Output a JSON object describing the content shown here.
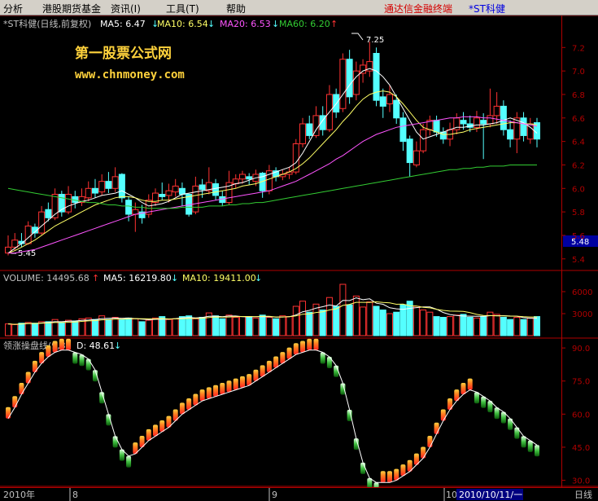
{
  "menu": {
    "items": [
      "分析",
      "港股期货基金",
      "资讯(I)",
      "工具(T)",
      "帮助"
    ],
    "brand": "通达信金融终端",
    "stock": "*ST科健"
  },
  "price_panel": {
    "label": "*ST科健(日线,前复权)",
    "ma5": "MA5: 6.47",
    "ma10": "MA10: 6.54",
    "ma20": "MA20: 6.53",
    "ma60": "MA60: 6.20",
    "watermark_name": "第一股票公式网",
    "watermark_url": "www.chnmoney.com",
    "high_label": "7.25",
    "low_label": "5.45",
    "current_price": "5.48",
    "colors": {
      "up": "#ff3232",
      "down": "#54ffff",
      "ma5": "#ffffff",
      "ma10": "#ffff66",
      "ma20": "#ff55ff",
      "ma60": "#33cc33",
      "axis": "#b00000"
    }
  },
  "volume_panel": {
    "label": "VOLUME: 14495.68",
    "ma5": "MA5: 16219.80",
    "ma10": "MA10: 19411.00"
  },
  "indicator_panel": {
    "label": "领涨操盘线(9,3)",
    "d_value": "D: 48.61"
  },
  "chart_data": [
    {
      "type": "candlestick",
      "title": "*ST科健(日线,前复权)",
      "y_ticks": [
        "7.2",
        "7.0",
        "6.8",
        "6.6",
        "6.4",
        "6.2",
        "6.0",
        "5.8",
        "5.6",
        "5.4"
      ],
      "ylim": [
        5.35,
        7.32
      ],
      "candles": [
        [
          5.45,
          5.5,
          5.6,
          5.43
        ],
        [
          5.5,
          5.56,
          5.62,
          5.47
        ],
        [
          5.55,
          5.53,
          5.62,
          5.5
        ],
        [
          5.53,
          5.68,
          5.72,
          5.52
        ],
        [
          5.67,
          5.62,
          5.7,
          5.58
        ],
        [
          5.62,
          5.8,
          5.85,
          5.6
        ],
        [
          5.82,
          5.75,
          5.88,
          5.72
        ],
        [
          5.75,
          5.95,
          6.0,
          5.73
        ],
        [
          5.95,
          5.8,
          5.98,
          5.76
        ],
        [
          5.8,
          5.95,
          6.02,
          5.78
        ],
        [
          5.93,
          5.88,
          5.98,
          5.83
        ],
        [
          5.88,
          5.93,
          6.0,
          5.85
        ],
        [
          5.92,
          6.0,
          6.06,
          5.89
        ],
        [
          6.0,
          5.96,
          6.08,
          5.92
        ],
        [
          5.97,
          6.06,
          6.12,
          5.94
        ],
        [
          6.06,
          6.0,
          6.14,
          5.96
        ],
        [
          6.0,
          6.1,
          6.18,
          5.97
        ],
        [
          6.12,
          5.92,
          6.13,
          5.88
        ],
        [
          5.9,
          5.78,
          5.93,
          5.72
        ],
        [
          5.78,
          5.82,
          5.88,
          5.63
        ],
        [
          5.8,
          5.75,
          5.86,
          5.7
        ],
        [
          5.78,
          5.9,
          5.95,
          5.75
        ],
        [
          5.88,
          5.96,
          6.0,
          5.85
        ],
        [
          5.95,
          5.93,
          6.05,
          5.9
        ],
        [
          5.94,
          5.98,
          6.04,
          5.88
        ],
        [
          5.97,
          6.02,
          6.08,
          5.93
        ],
        [
          6.0,
          5.95,
          6.05,
          5.85
        ],
        [
          5.95,
          5.78,
          5.96,
          5.76
        ],
        [
          5.8,
          6.02,
          6.1,
          5.78
        ],
        [
          6.03,
          5.99,
          6.08,
          5.92
        ],
        [
          5.98,
          6.05,
          6.18,
          5.95
        ],
        [
          6.04,
          5.94,
          6.08,
          5.9
        ],
        [
          5.93,
          5.88,
          5.98,
          5.85
        ],
        [
          5.88,
          6.05,
          6.15,
          5.86
        ],
        [
          6.04,
          6.08,
          6.12,
          6.0
        ],
        [
          6.08,
          6.12,
          6.15,
          6.04
        ],
        [
          6.1,
          6.08,
          6.13,
          6.03
        ],
        [
          6.06,
          6.12,
          6.16,
          6.02
        ],
        [
          6.13,
          5.98,
          6.14,
          5.92
        ],
        [
          5.98,
          6.15,
          6.2,
          5.95
        ],
        [
          6.15,
          6.1,
          6.18,
          6.06
        ],
        [
          6.1,
          6.12,
          6.16,
          6.07
        ],
        [
          6.12,
          6.14,
          6.18,
          6.08
        ],
        [
          6.14,
          6.38,
          6.42,
          6.12
        ],
        [
          6.38,
          6.55,
          6.6,
          6.35
        ],
        [
          6.55,
          6.45,
          6.62,
          6.42
        ],
        [
          6.45,
          6.62,
          6.7,
          6.43
        ],
        [
          6.62,
          6.5,
          6.7,
          6.45
        ],
        [
          6.5,
          6.8,
          6.88,
          6.48
        ],
        [
          6.8,
          6.65,
          6.85,
          6.6
        ],
        [
          6.68,
          7.1,
          7.15,
          6.65
        ],
        [
          7.1,
          6.78,
          7.18,
          6.72
        ],
        [
          6.8,
          7.0,
          7.08,
          6.75
        ],
        [
          6.98,
          7.05,
          7.1,
          6.9
        ],
        [
          7.0,
          7.08,
          7.25,
          6.95
        ],
        [
          7.15,
          6.75,
          7.2,
          6.7
        ],
        [
          6.78,
          6.7,
          6.85,
          6.6
        ],
        [
          6.72,
          6.8,
          6.88,
          6.65
        ],
        [
          6.75,
          6.6,
          6.8,
          6.55
        ],
        [
          6.6,
          6.4,
          6.65,
          6.32
        ],
        [
          6.42,
          6.22,
          6.45,
          6.1
        ],
        [
          6.2,
          6.32,
          6.4,
          6.18
        ],
        [
          6.32,
          6.5,
          6.55,
          6.3
        ],
        [
          6.5,
          6.58,
          6.62,
          6.45
        ],
        [
          6.58,
          6.48,
          6.62,
          6.44
        ],
        [
          6.48,
          6.42,
          6.52,
          6.38
        ],
        [
          6.42,
          6.5,
          6.56,
          6.36
        ],
        [
          6.5,
          6.6,
          6.64,
          6.46
        ],
        [
          6.58,
          6.55,
          6.65,
          6.5
        ],
        [
          6.55,
          6.52,
          6.62,
          6.48
        ],
        [
          6.52,
          6.6,
          6.66,
          6.48
        ],
        [
          6.58,
          6.55,
          6.64,
          6.25
        ],
        [
          6.55,
          6.62,
          6.85,
          6.52
        ],
        [
          6.62,
          6.7,
          6.82,
          6.55
        ],
        [
          6.7,
          6.5,
          6.75,
          6.45
        ],
        [
          6.5,
          6.42,
          6.58,
          6.35
        ],
        [
          6.42,
          6.6,
          6.65,
          6.3
        ],
        [
          6.6,
          6.45,
          6.65,
          6.4
        ],
        [
          6.42,
          6.55,
          6.6,
          6.38
        ],
        [
          6.56,
          6.42,
          6.6,
          6.35
        ]
      ],
      "series": [
        {
          "name": "MA5",
          "color": "#ffffff",
          "values": [
            5.45,
            5.49,
            5.53,
            5.58,
            5.63,
            5.68,
            5.73,
            5.78,
            5.82,
            5.85,
            5.87,
            5.89,
            5.9,
            5.92,
            5.94,
            5.95,
            5.96,
            5.98,
            5.95,
            5.92,
            5.88,
            5.85,
            5.86,
            5.87,
            5.89,
            5.92,
            5.95,
            5.96,
            5.97,
            5.98,
            5.99,
            6.0,
            6.01,
            6.02,
            6.04,
            6.05,
            6.07,
            6.09,
            6.1,
            6.12,
            6.14,
            6.16,
            6.18,
            6.22,
            6.3,
            6.4,
            6.5,
            6.58,
            6.65,
            6.72,
            6.8,
            6.88,
            6.95,
            7.0,
            7.02,
            7.0,
            6.95,
            6.88,
            6.78,
            6.68,
            6.58,
            6.48,
            6.42,
            6.44,
            6.46,
            6.48,
            6.5,
            6.52,
            6.52,
            6.53,
            6.54,
            6.54,
            6.55,
            6.56,
            6.58,
            6.6,
            6.58,
            6.56,
            6.52,
            6.47
          ]
        },
        {
          "name": "MA10",
          "color": "#ffff66",
          "values": [
            5.45,
            5.47,
            5.5,
            5.53,
            5.56,
            5.6,
            5.64,
            5.68,
            5.71,
            5.74,
            5.77,
            5.8,
            5.83,
            5.86,
            5.88,
            5.9,
            5.92,
            5.93,
            5.93,
            5.92,
            5.9,
            5.89,
            5.89,
            5.9,
            5.9,
            5.91,
            5.92,
            5.93,
            5.94,
            5.95,
            5.96,
            5.97,
            5.98,
            5.99,
            6.0,
            6.02,
            6.03,
            6.04,
            6.06,
            6.08,
            6.1,
            6.12,
            6.14,
            6.17,
            6.21,
            6.26,
            6.32,
            6.38,
            6.44,
            6.5,
            6.57,
            6.63,
            6.7,
            6.76,
            6.8,
            6.82,
            6.83,
            6.82,
            6.78,
            6.72,
            6.65,
            6.58,
            6.52,
            6.5,
            6.48,
            6.46,
            6.46,
            6.47,
            6.48,
            6.5,
            6.51,
            6.52,
            6.53,
            6.54,
            6.55,
            6.56,
            6.56,
            6.55,
            6.55,
            6.54
          ]
        },
        {
          "name": "MA20",
          "color": "#ff55ff",
          "values": [
            5.45,
            5.45,
            5.46,
            5.47,
            5.48,
            5.5,
            5.52,
            5.54,
            5.56,
            5.58,
            5.6,
            5.62,
            5.64,
            5.66,
            5.68,
            5.7,
            5.72,
            5.74,
            5.76,
            5.78,
            5.79,
            5.8,
            5.81,
            5.82,
            5.83,
            5.84,
            5.85,
            5.86,
            5.87,
            5.88,
            5.89,
            5.9,
            5.91,
            5.92,
            5.93,
            5.94,
            5.95,
            5.96,
            5.97,
            5.98,
            6.0,
            6.02,
            6.04,
            6.06,
            6.09,
            6.12,
            6.15,
            6.18,
            6.21,
            6.25,
            6.28,
            6.32,
            6.36,
            6.4,
            6.43,
            6.46,
            6.48,
            6.5,
            6.52,
            6.53,
            6.54,
            6.55,
            6.56,
            6.57,
            6.58,
            6.59,
            6.6,
            6.6,
            6.61,
            6.61,
            6.61,
            6.6,
            6.6,
            6.59,
            6.58,
            6.57,
            6.56,
            6.55,
            6.54,
            6.53
          ]
        },
        {
          "name": "MA60",
          "color": "#33cc33",
          "values": [
            6.0,
            5.99,
            5.98,
            5.97,
            5.96,
            5.95,
            5.94,
            5.93,
            5.92,
            5.91,
            5.9,
            5.89,
            5.88,
            5.88,
            5.87,
            5.86,
            5.86,
            5.85,
            5.85,
            5.84,
            5.84,
            5.83,
            5.83,
            5.83,
            5.83,
            5.83,
            5.84,
            5.84,
            5.84,
            5.84,
            5.85,
            5.85,
            5.85,
            5.86,
            5.86,
            5.87,
            5.87,
            5.88,
            5.88,
            5.89,
            5.9,
            5.91,
            5.92,
            5.93,
            5.94,
            5.95,
            5.96,
            5.97,
            5.98,
            5.99,
            6.0,
            6.01,
            6.02,
            6.03,
            6.04,
            6.05,
            6.06,
            6.07,
            6.08,
            6.09,
            6.1,
            6.11,
            6.12,
            6.13,
            6.14,
            6.15,
            6.16,
            6.16,
            6.17,
            6.17,
            6.18,
            6.18,
            6.19,
            6.19,
            6.19,
            6.2,
            6.2,
            6.2,
            6.2,
            6.2
          ]
        }
      ]
    },
    {
      "type": "bar",
      "title": "VOLUME",
      "y_ticks": [
        "6000",
        "3000"
      ],
      "ylim": [
        0,
        7000
      ],
      "values": [
        1600,
        1500,
        1700,
        1800,
        1700,
        1900,
        1900,
        2200,
        1800,
        2100,
        2000,
        2300,
        2400,
        2200,
        2700,
        2200,
        2500,
        2200,
        2400,
        2300,
        1900,
        2100,
        2400,
        2600,
        2200,
        2300,
        2600,
        2700,
        2300,
        2500,
        3100,
        2700,
        2300,
        2800,
        2500,
        2600,
        2600,
        2400,
        2800,
        2500,
        2300,
        2700,
        2600,
        4000,
        4700,
        3200,
        4300,
        3500,
        5200,
        4000,
        7000,
        4200,
        5400,
        3900,
        4600,
        4000,
        3500,
        3000,
        3200,
        4200,
        4700,
        4000,
        3500,
        3200,
        2600,
        2500,
        2600,
        2800,
        2900,
        2500,
        2400,
        2600,
        3200,
        2900,
        2500,
        2200,
        2500,
        2200,
        2400,
        2600
      ]
    },
    {
      "type": "line",
      "title": "领涨操盘线(9,3)",
      "y_ticks": [
        "90.0",
        "75.0",
        "60.0",
        "45.0",
        "30.0"
      ],
      "ylim": [
        28,
        93
      ],
      "x_tick_labels": [
        "2010年",
        "8",
        "9",
        "10"
      ],
      "cursor_date": "2010/10/11/一",
      "period": "日线",
      "values": [
        58,
        63,
        69,
        74,
        79,
        83,
        86,
        88,
        89,
        89,
        88,
        87,
        85,
        80,
        70,
        60,
        50,
        44,
        41,
        42,
        45,
        48,
        50,
        52,
        54,
        57,
        60,
        62,
        64,
        66,
        67,
        68,
        69,
        70,
        71,
        72,
        73,
        75,
        77,
        79,
        81,
        83,
        85,
        87,
        88,
        89,
        89,
        88,
        86,
        82,
        74,
        62,
        49,
        38,
        31,
        29,
        29,
        29,
        30,
        32,
        34,
        37,
        40,
        45,
        51,
        57,
        62,
        66,
        69,
        71,
        70,
        68,
        66,
        63,
        61,
        58,
        54,
        50,
        48,
        46
      ]
    }
  ]
}
